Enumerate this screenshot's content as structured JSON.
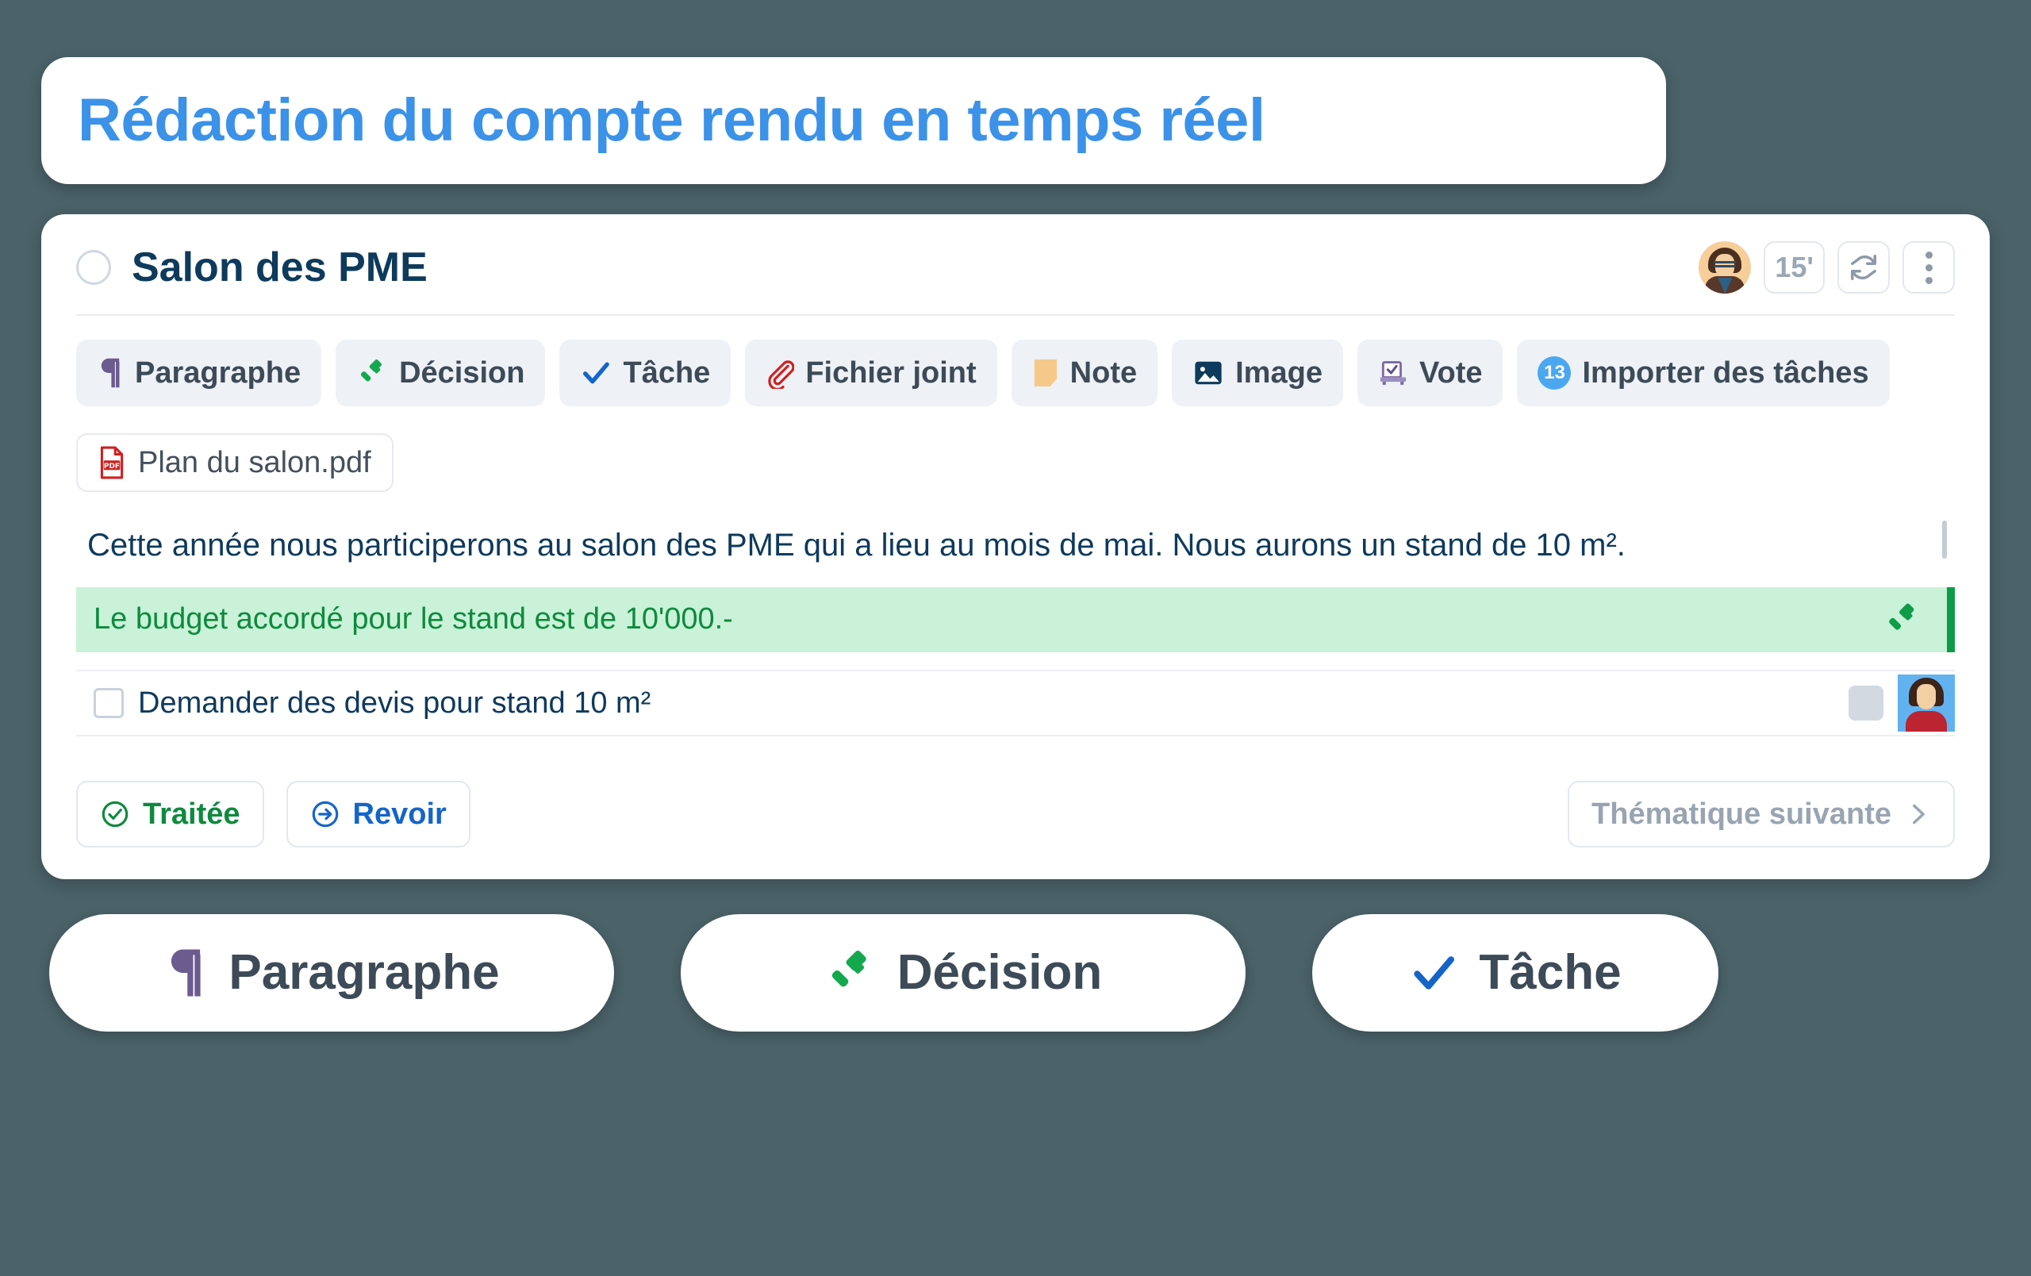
{
  "banner": {
    "title": "Rédaction du compte rendu en temps réel",
    "accent_color": "#3b92e8"
  },
  "card": {
    "topic_title": "Salon des PME",
    "head_tools": {
      "duration": "15'",
      "refresh_icon": "refresh-icon",
      "more_icon": "more-vertical-icon",
      "avatar_icon": "avatar-woman-glasses"
    },
    "toolbar": [
      {
        "label": "Paragraphe",
        "icon": "pilcrow-icon",
        "icon_color": "#6b5b8e"
      },
      {
        "label": "Décision",
        "icon": "gavel-icon",
        "icon_color": "#14a84e"
      },
      {
        "label": "Tâche",
        "icon": "check-icon",
        "icon_color": "#1565c9"
      },
      {
        "label": "Fichier joint",
        "icon": "paperclip-icon",
        "icon_color": "#cf2020"
      },
      {
        "label": "Note",
        "icon": "sticky-note-icon",
        "icon_color": "#f5c98a"
      },
      {
        "label": "Image",
        "icon": "image-icon",
        "icon_color": "#0e3a5c"
      },
      {
        "label": "Vote",
        "icon": "ballot-box-icon",
        "icon_color": "#7a6ba0"
      },
      {
        "label": "Importer des tâches",
        "icon": "count-badge",
        "badge": "13",
        "icon_color": "#4aa7f0"
      }
    ],
    "attachment": {
      "filename": "Plan du salon.pdf",
      "icon": "pdf-file-icon",
      "icon_color": "#cf2020"
    },
    "content": {
      "paragraph": "Cette année nous participerons au salon des PME qui a lieu au mois de mai. Nous aurons un stand de 10 m².",
      "decision": {
        "text": "Le budget accordé pour le stand est de 10'000.-",
        "bg_color": "#c9f2d8",
        "text_color": "#0e8a3e",
        "bar_color": "#0e9c49",
        "icon": "gavel-icon"
      },
      "task": {
        "text": "Demander des devis pour stand 10 m²",
        "checked": false,
        "assignee_icon": "avatar-woman-red"
      }
    },
    "footer": {
      "processed_label": "Traitée",
      "processed_icon": "check-circle-icon",
      "processed_color": "#0e8a3e",
      "review_label": "Revoir",
      "review_icon": "arrow-right-circle-icon",
      "review_color": "#1565c9",
      "next_label": "Thématique suivante",
      "next_icon": "chevron-right-icon",
      "next_color": "#98a4b1"
    }
  },
  "bottom_pills": [
    {
      "label": "Paragraphe",
      "icon": "pilcrow-icon",
      "icon_color": "#6b5b8e"
    },
    {
      "label": "Décision",
      "icon": "gavel-icon",
      "icon_color": "#14a84e"
    },
    {
      "label": "Tâche",
      "icon": "check-icon",
      "icon_color": "#1565c9"
    }
  ],
  "page": {
    "background_color": "#4a6268"
  }
}
